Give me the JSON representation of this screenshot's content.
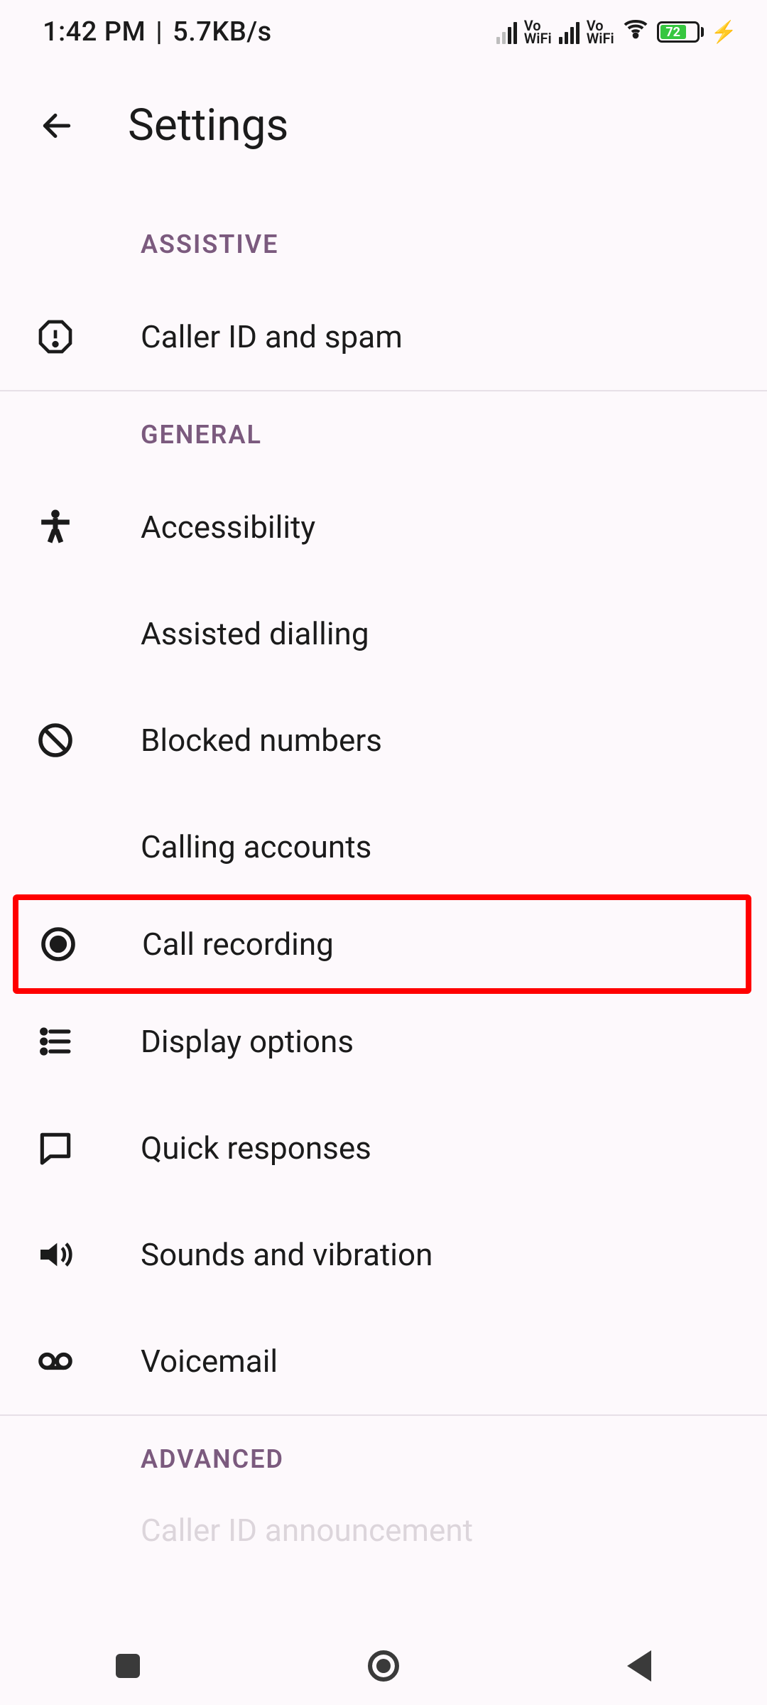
{
  "status": {
    "time": "1:42 PM",
    "net_rate": "5.7KB/s",
    "vo_label": "Vo\nWiFi",
    "battery_pct": "72"
  },
  "header": {
    "title": "Settings"
  },
  "sections": {
    "assistive": {
      "label": "ASSISTIVE"
    },
    "general": {
      "label": "GENERAL"
    },
    "advanced": {
      "label": "ADVANCED"
    }
  },
  "items": {
    "caller_id": {
      "label": "Caller ID and spam"
    },
    "accessibility": {
      "label": "Accessibility"
    },
    "assisted_dialling": {
      "label": "Assisted dialling"
    },
    "blocked_numbers": {
      "label": "Blocked numbers"
    },
    "calling_accounts": {
      "label": "Calling accounts"
    },
    "call_recording": {
      "label": "Call recording"
    },
    "display_options": {
      "label": "Display options"
    },
    "quick_responses": {
      "label": "Quick responses"
    },
    "sounds_vibration": {
      "label": "Sounds and vibration"
    },
    "voicemail": {
      "label": "Voicemail"
    },
    "caller_id_announce": {
      "label": "Caller ID announcement"
    }
  }
}
